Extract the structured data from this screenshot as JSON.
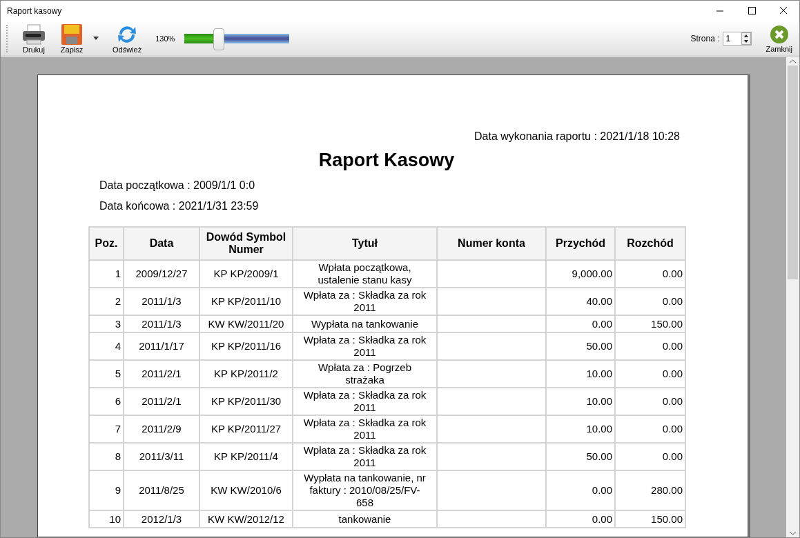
{
  "window": {
    "title": "Raport kasowy"
  },
  "toolbar": {
    "buttons": [
      {
        "kind": "print",
        "label": "Drukuj"
      },
      {
        "kind": "save",
        "label": "Zapisz"
      },
      {
        "kind": "refresh",
        "label": "Odśwież"
      }
    ],
    "zoom": {
      "reading": "130%",
      "level": 0.33
    },
    "page_label": "Strona :",
    "page_value": "1",
    "close_label": "Zamknij"
  },
  "report": {
    "generated": "Data wykonania raportu : 2021/1/18 10:28",
    "title": "Raport Kasowy",
    "date_from": "Data początkowa : 2009/1/1 0:0",
    "date_to": "Data końcowa : 2021/1/31 23:59",
    "table": {
      "columns": [
        "Poz.",
        "Data",
        "Dowód Symbol Numer",
        "Tytuł",
        "Numer konta",
        "Przychód",
        "Rozchód"
      ],
      "rows": [
        [
          "1",
          "2009/12/27",
          "KP  KP/2009/1",
          "Wpłata początkowa, ustalenie stanu kasy",
          "",
          "9,000.00",
          "0.00"
        ],
        [
          "2",
          "2011/1/3",
          "KP  KP/2011/10",
          "Wpłata za : Składka za rok 2011",
          "",
          "40.00",
          "0.00"
        ],
        [
          "3",
          "2011/1/3",
          "KW  KW/2011/20",
          "Wypłata na tankowanie",
          "",
          "0.00",
          "150.00"
        ],
        [
          "4",
          "2011/1/17",
          "KP  KP/2011/16",
          "Wpłata za : Składka za rok 2011",
          "",
          "50.00",
          "0.00"
        ],
        [
          "5",
          "2011/2/1",
          "KP  KP/2011/2",
          "Wpłata za : Pogrzeb strażaka",
          "",
          "10.00",
          "0.00"
        ],
        [
          "6",
          "2011/2/1",
          "KP  KP/2011/30",
          "Wpłata za : Składka za rok 2011",
          "",
          "10.00",
          "0.00"
        ],
        [
          "7",
          "2011/2/9",
          "KP  KP/2011/27",
          "Wpłata za : Składka za rok 2011",
          "",
          "10.00",
          "0.00"
        ],
        [
          "8",
          "2011/3/11",
          "KP  KP/2011/4",
          "Wpłata za : Składka za rok 2011",
          "",
          "50.00",
          "0.00"
        ],
        [
          "9",
          "2011/8/25",
          "KW  KW/2010/6",
          "Wypłata na tankowanie, nr faktury : 2010/08/25/FV-658",
          "",
          "0.00",
          "280.00"
        ],
        [
          "10",
          "2012/1/3",
          "KW  KW/2012/12",
          "tankowanie",
          "",
          "0.00",
          "150.00"
        ]
      ]
    }
  }
}
